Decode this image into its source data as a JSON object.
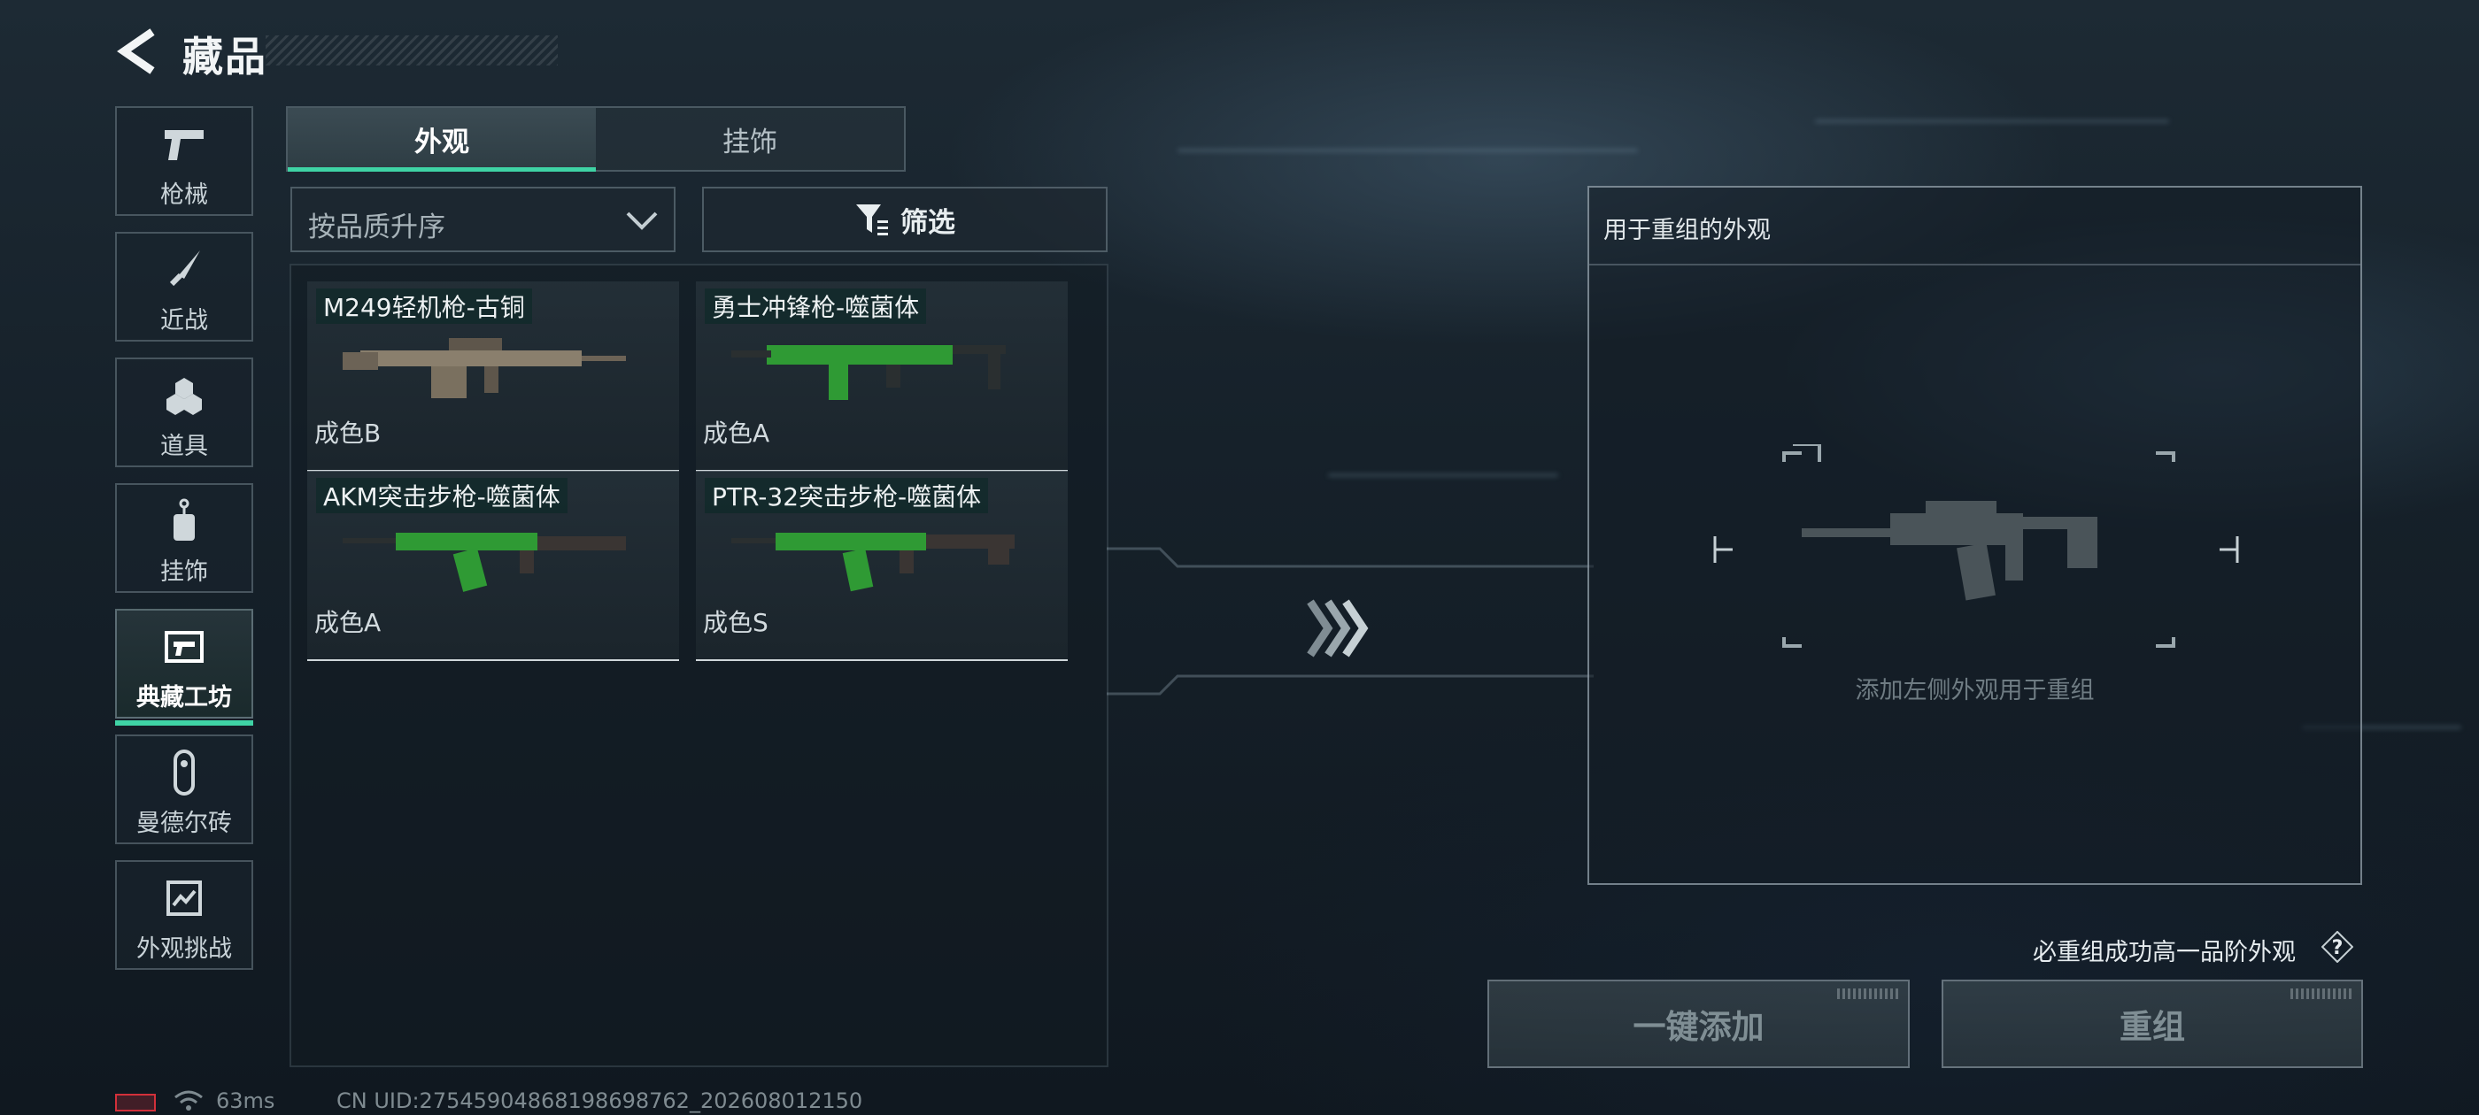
{
  "header": {
    "title": "藏品",
    "back_icon": "back-arrow-icon"
  },
  "nav": [
    {
      "label": "枪械",
      "icon": "pistol-icon",
      "active": false
    },
    {
      "label": "近战",
      "icon": "knife-icon",
      "active": false
    },
    {
      "label": "道具",
      "icon": "grenades-icon",
      "active": false
    },
    {
      "label": "挂饰",
      "icon": "charm-tag-icon",
      "active": false
    },
    {
      "label": "典藏工坊",
      "icon": "workshop-icon",
      "active": true
    },
    {
      "label": "曼德尔砖",
      "icon": "mandel-brick-icon",
      "active": false
    },
    {
      "label": "外观挑战",
      "icon": "challenge-map-icon",
      "active": false
    }
  ],
  "tabs": [
    {
      "label": "外观",
      "active": true
    },
    {
      "label": "挂饰",
      "active": false
    }
  ],
  "sort": {
    "value": "按品质升序"
  },
  "filter": {
    "label": "筛选",
    "icon": "filter-funnel-icon"
  },
  "items": [
    {
      "name": "M249轻机枪-古铜",
      "grade": "成色B",
      "skin_color": "#8a7f6d"
    },
    {
      "name": "勇士冲锋枪-噬菌体",
      "grade": "成色A",
      "skin_color": "#2f9a34"
    },
    {
      "name": "AKM突击步枪-噬菌体",
      "grade": "成色A",
      "skin_color": "#2f9a34"
    },
    {
      "name": "PTR-32突击步枪-噬菌体",
      "grade": "成色S",
      "skin_color": "#2f9a34"
    }
  ],
  "recompose": {
    "title": "用于重组的外观",
    "hint": "添加左侧外观用于重组",
    "guarantee": "必重组成功高一品阶外观",
    "help_icon": "question-mark-icon"
  },
  "actions": {
    "add_all": "一键添加",
    "recompose": "重组"
  },
  "status": {
    "ping": "63ms",
    "uid": "CN UID:27545904868198698762_202608012150"
  },
  "colors": {
    "accent": "#3fd3a5",
    "battery_low": "#d2303a"
  }
}
